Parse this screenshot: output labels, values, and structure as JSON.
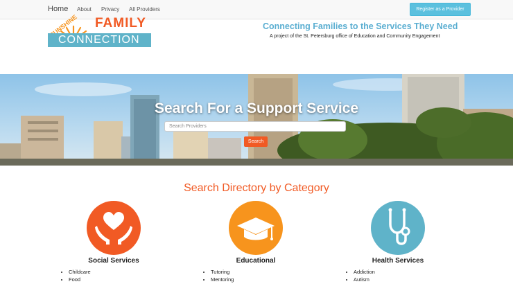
{
  "nav": {
    "home": "Home",
    "about": "About",
    "privacy": "Privacy",
    "all_providers": "All Providers",
    "register_button": "Register as a Provider"
  },
  "logo": {
    "sunshine": "SUNSHINE",
    "family": "FAMILY",
    "connection": "CONNECTION"
  },
  "header": {
    "tagline": "Connecting Families to the Services They Need",
    "subtagline": "A project of the St. Petersburg office of Education and Community Engagement"
  },
  "hero": {
    "title": "Search For a Support Service",
    "search_placeholder": "Search Providers",
    "search_button": "Search"
  },
  "categories_section": {
    "title": "Search Directory by Category",
    "categories": [
      {
        "label": "Social Services",
        "icon": "heart-hands-icon",
        "color": "#f15a24",
        "items": [
          "Childcare",
          "Food"
        ]
      },
      {
        "label": "Educational",
        "icon": "graduation-cap-icon",
        "color": "#f7941d",
        "items": [
          "Tutoring",
          "Mentoring"
        ]
      },
      {
        "label": "Health Services",
        "icon": "stethoscope-icon",
        "color": "#5fb3c9",
        "items": [
          "Addiction",
          "Autism"
        ]
      }
    ]
  },
  "colors": {
    "accent_orange": "#f15a24",
    "accent_blue": "#5aaed1",
    "register_button": "#5bc0de"
  }
}
